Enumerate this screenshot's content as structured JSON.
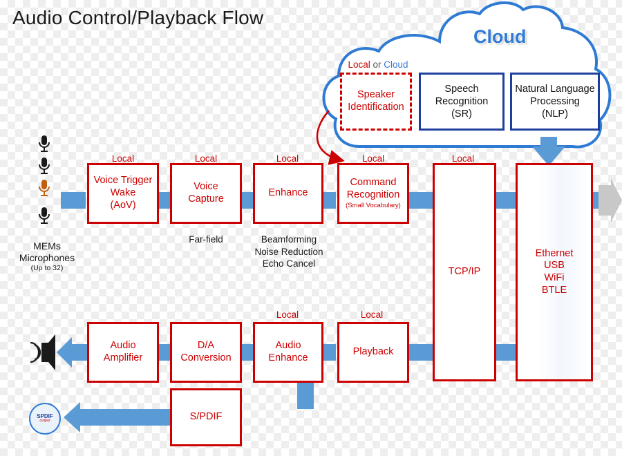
{
  "title": "Audio Control/Playback Flow",
  "cloud_label": "Cloud",
  "local_cloud_label": {
    "local": "Local",
    "or": " or ",
    "cloud": "Cloud"
  },
  "colors": {
    "red": "#cc0000",
    "blue_box": "#1f3f9e",
    "arrow_blue": "#5b9bd5",
    "cloud_blue": "#2f7bd4",
    "gray_arrow": "#c8c8c8",
    "background": "#ffffff"
  },
  "labels": {
    "local": "Local",
    "far_field": "Far-field",
    "beamforming": "Beamforming\nNoise Reduction\nEcho Cancel",
    "beamforming_lines": [
      "Beamforming",
      "Noise Reduction",
      "Echo Cancel"
    ],
    "mems_line1": "MEMs",
    "mems_line2": "Microphones",
    "mems_line3": "(Up to 32)",
    "spdif_badge_line1": "SPDIF",
    "spdif_badge_line2": "output"
  },
  "cloud_boxes": [
    {
      "name": "speaker-identification",
      "lines": [
        "Speaker",
        "Identification"
      ],
      "style": "dashed-red"
    },
    {
      "name": "speech-recognition",
      "lines": [
        "Speech",
        "Recognition",
        "(SR)"
      ],
      "style": "blue"
    },
    {
      "name": "natural-language-processing",
      "lines": [
        "Natural Language",
        "Processing",
        "(NLP)"
      ],
      "style": "blue"
    }
  ],
  "capture_chain": [
    {
      "name": "voice-trigger-wake",
      "tag": "Local",
      "lines": [
        "Voice Trigger",
        "Wake",
        "(AoV)"
      ],
      "sub": "",
      "caption": ""
    },
    {
      "name": "voice-capture",
      "tag": "Local",
      "lines": [
        "Voice",
        "Capture"
      ],
      "sub": "",
      "caption": "Far-field"
    },
    {
      "name": "enhance",
      "tag": "Local",
      "lines": [
        "Enhance"
      ],
      "sub": "",
      "caption": "Beamforming / Noise Reduction / Echo Cancel"
    },
    {
      "name": "command-recognition",
      "tag": "Local",
      "lines": [
        "Command",
        "Recognition"
      ],
      "sub": "(Small Vocabulary)",
      "caption": ""
    }
  ],
  "playback_chain": [
    {
      "name": "audio-amplifier",
      "tag": "",
      "lines": [
        "Audio",
        "Amplifier"
      ]
    },
    {
      "name": "da-conversion",
      "tag": "",
      "lines": [
        "D/A",
        "Conversion"
      ]
    },
    {
      "name": "audio-enhance",
      "tag": "Local",
      "lines": [
        "Audio",
        "Enhance"
      ]
    },
    {
      "name": "playback",
      "tag": "Local",
      "lines": [
        "Playback"
      ]
    }
  ],
  "spdif_box": {
    "name": "spdif",
    "lines": [
      "S/PDIF"
    ]
  },
  "tcpip_box": {
    "name": "tcpip",
    "tag": "Local",
    "lines": [
      "TCP/IP"
    ]
  },
  "network_box": {
    "name": "network-interfaces",
    "lines": [
      "Ethernet",
      "USB",
      "WiFi",
      "BTLE"
    ]
  }
}
